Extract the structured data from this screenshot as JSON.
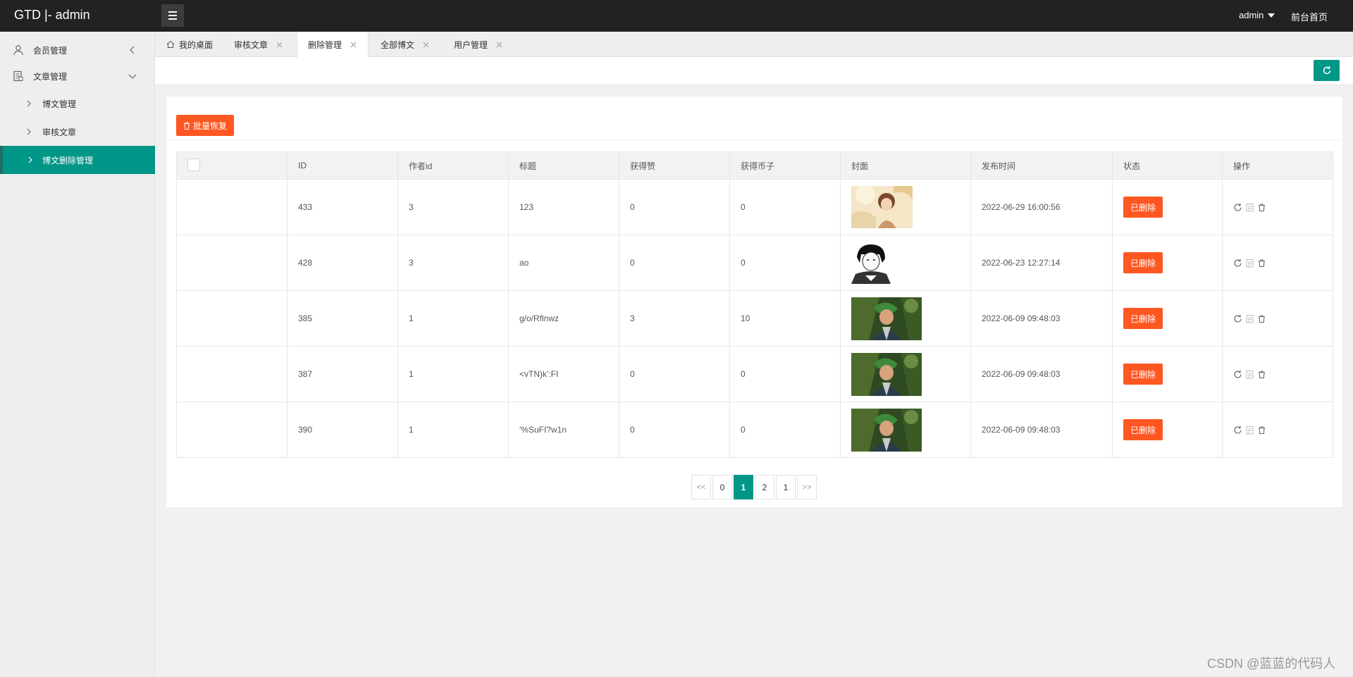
{
  "header": {
    "brand": "GTD |- admin",
    "user": "admin",
    "front_link": "前台首页"
  },
  "sidebar": {
    "groups": [
      {
        "label": "会员管理",
        "icon": "user-icon",
        "arrow": "chevron-left-icon"
      },
      {
        "label": "文章管理",
        "icon": "document-icon",
        "arrow": "chevron-down-icon"
      }
    ],
    "sub_items": [
      {
        "label": "博文管理",
        "active": false
      },
      {
        "label": "审核文章",
        "active": false
      },
      {
        "label": "博文删除管理",
        "active": true
      }
    ]
  },
  "tabs": [
    {
      "label": "我的桌面",
      "closable": false,
      "active": false
    },
    {
      "label": "审核文章",
      "closable": true,
      "active": false
    },
    {
      "label": "删除管理",
      "closable": true,
      "active": true
    },
    {
      "label": "全部博文",
      "closable": true,
      "active": false
    },
    {
      "label": "用户管理",
      "closable": true,
      "active": false
    }
  ],
  "toolbar": {
    "batch_restore": "批量恢复"
  },
  "table": {
    "columns": [
      "",
      "ID",
      "作者id",
      "标题",
      "获得赞",
      "获得币子",
      "封面",
      "发布时间",
      "状态",
      "操作"
    ],
    "rows": [
      {
        "id": "433",
        "author_id": "3",
        "title": "123",
        "likes": "0",
        "coins": "0",
        "cover": "anime-girl-cover",
        "time": "2022-06-29 16:00:56",
        "status": "已删除"
      },
      {
        "id": "428",
        "author_id": "3",
        "title": "ao",
        "likes": "0",
        "coins": "0",
        "cover": "manga-boy-cover",
        "time": "2022-06-23 12:27:14",
        "status": "已删除"
      },
      {
        "id": "385",
        "author_id": "1",
        "title": "g/o/Rflnwz",
        "likes": "3",
        "coins": "10",
        "cover": "green-hair-cover",
        "time": "2022-06-09 09:48:03",
        "status": "已删除"
      },
      {
        "id": "387",
        "author_id": "1",
        "title": "<vTN)k':FI",
        "likes": "0",
        "coins": "0",
        "cover": "green-hair-cover",
        "time": "2022-06-09 09:48:03",
        "status": "已删除"
      },
      {
        "id": "390",
        "author_id": "1",
        "title": "'%SuFI?w1n",
        "likes": "0",
        "coins": "0",
        "cover": "green-hair-cover",
        "time": "2022-06-09 09:48:03",
        "status": "已删除"
      }
    ]
  },
  "pagination": {
    "pages": [
      "<<",
      "0",
      "1",
      "2",
      "1",
      ">>"
    ],
    "current_index": 2
  },
  "watermark": "CSDN @蓝蓝的代码人",
  "colors": {
    "header": "#222222",
    "accent": "#009688",
    "danger": "#ff5722"
  }
}
